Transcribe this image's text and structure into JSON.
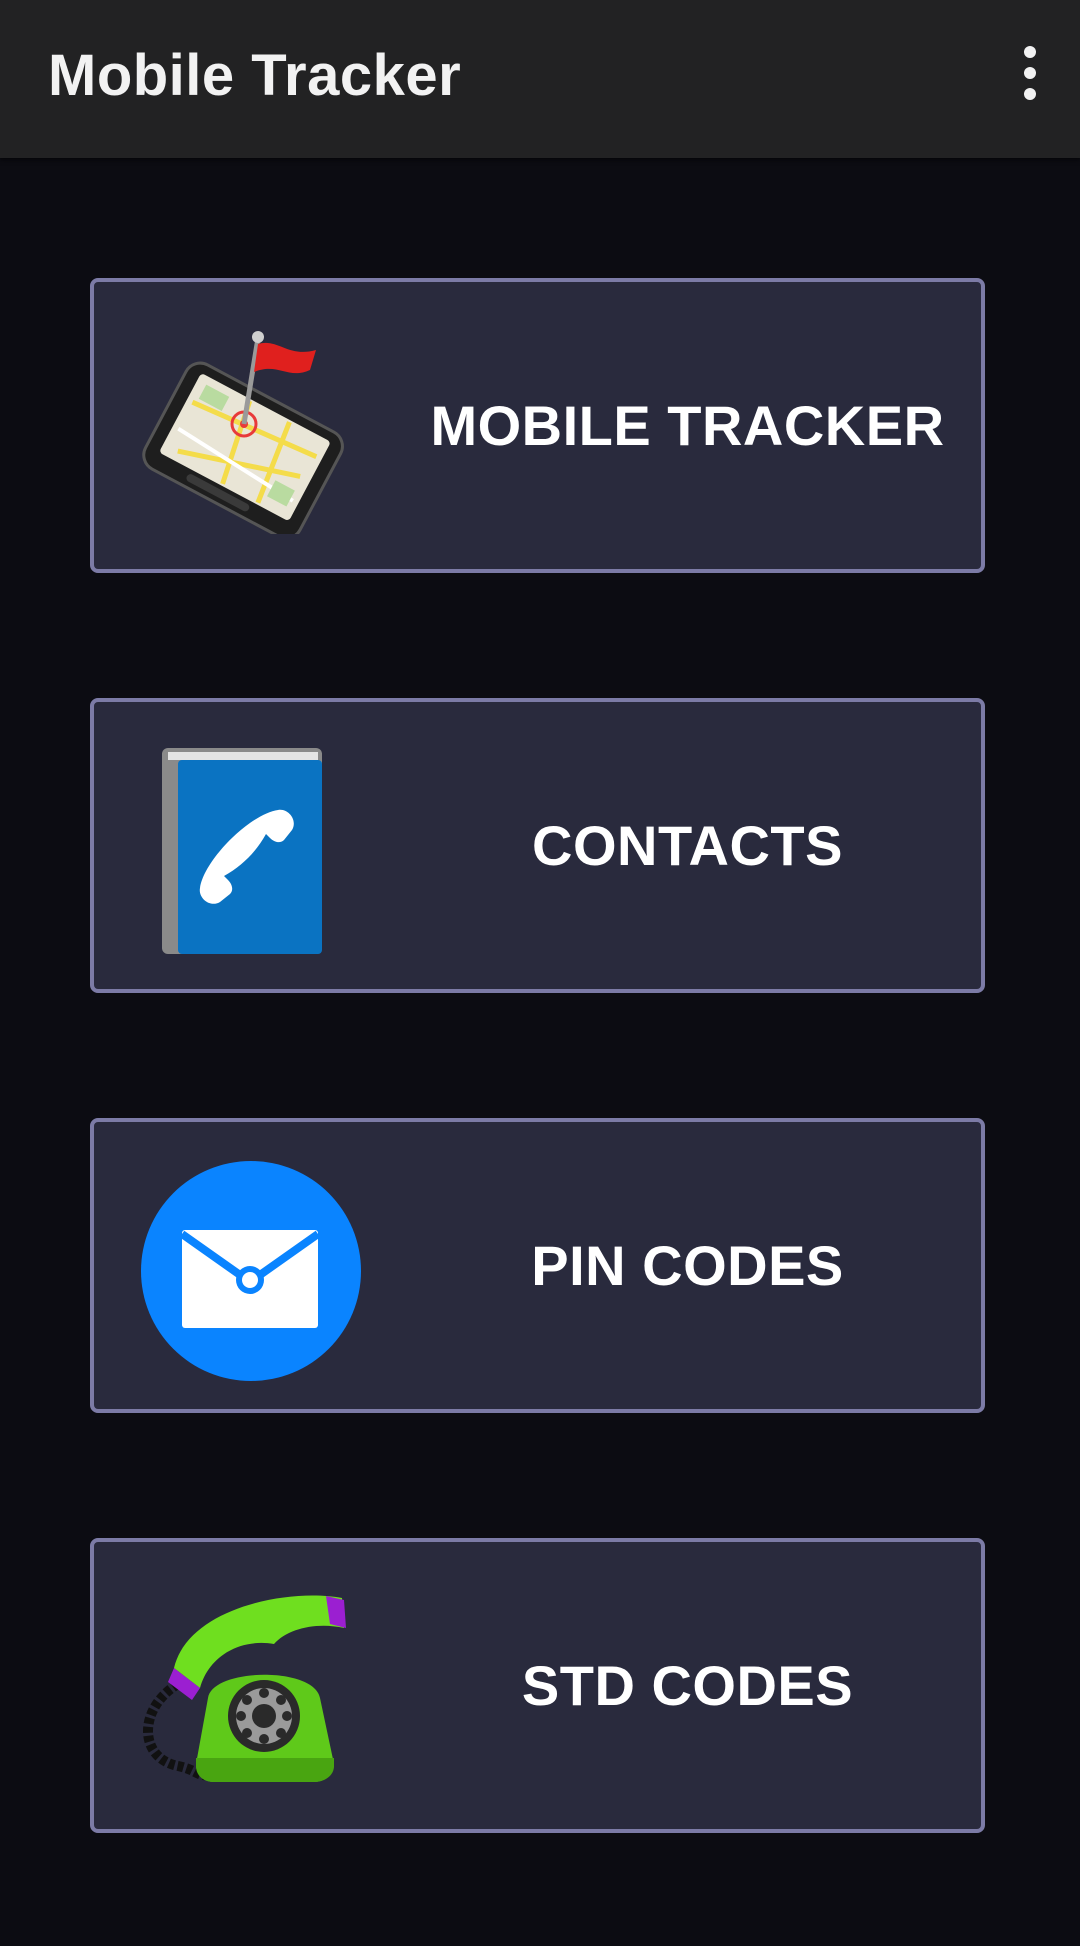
{
  "appbar": {
    "title": "Mobile Tracker",
    "overflow_icon": "more-vert-icon"
  },
  "menu": [
    {
      "id": "mobile-tracker",
      "label": "MOBILE TRACKER",
      "icon": "phone-map-flag-icon"
    },
    {
      "id": "contacts",
      "label": "CONTACTS",
      "icon": "phone-book-icon"
    },
    {
      "id": "pin-codes",
      "label": "PIN CODES",
      "icon": "envelope-icon"
    },
    {
      "id": "std-codes",
      "label": "STD CODES",
      "icon": "rotary-phone-icon"
    }
  ],
  "colors": {
    "background": "#0c0c12",
    "appbar": "#222223",
    "card": "#292a3d",
    "card_border": "#7c7ba6",
    "envelope_blue": "#0a84ff",
    "book_blue": "#0a73c2",
    "phone_green": "#6fdf1f"
  }
}
